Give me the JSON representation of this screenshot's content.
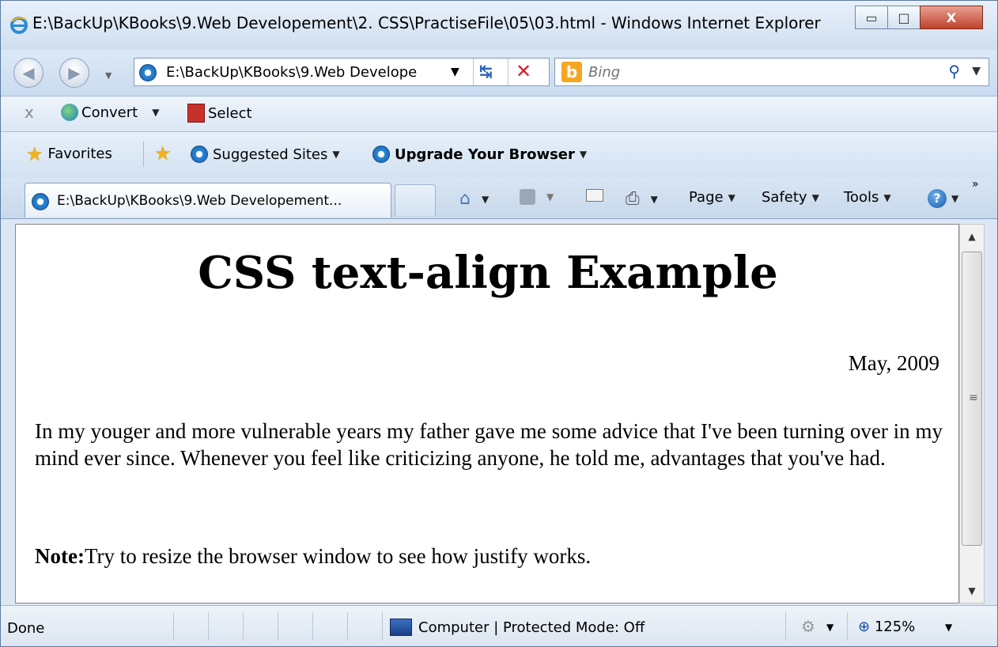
{
  "window": {
    "title": "E:\\BackUp\\KBooks\\9.Web Developement\\2. CSS\\PractiseFile\\05\\03.html - Windows Internet Explorer",
    "minimize_glyph": "▭",
    "maximize_glyph": "□",
    "close_glyph": "X"
  },
  "nav": {
    "back_glyph": "◀",
    "forward_glyph": "▶",
    "address": "E:\\BackUp\\KBooks\\9.Web Develope",
    "refresh_glyph": "↹",
    "stop_glyph": "✕"
  },
  "search": {
    "placeholder": "Bing",
    "logo_letter": "b"
  },
  "convert_toolbar": {
    "close_glyph": "x",
    "convert_label": "Convert",
    "select_label": "Select"
  },
  "favorites_bar": {
    "favorites_label": "Favorites",
    "suggested_sites_label": "Suggested Sites",
    "upgrade_label": "Upgrade Your Browser"
  },
  "tabs": [
    {
      "label": "E:\\BackUp\\KBooks\\9.Web Developement..."
    }
  ],
  "command_bar": {
    "page_label": "Page",
    "safety_label": "Safety",
    "tools_label": "Tools",
    "help_glyph": "?",
    "more_glyph": "»"
  },
  "page": {
    "heading": "CSS text-align Example",
    "date": "May, 2009",
    "paragraph": "In my youger and more vulnerable years my father gave me some advice that I've been turning over in my mind ever since. Whenever you feel like criticizing anyone, he told me, advantages that you've had.",
    "note_label": "Note:",
    "note_text": "Try to resize the browser window to see how justify works."
  },
  "status_bar": {
    "status": "Done",
    "zone": "Computer | Protected Mode: Off",
    "zoom": "125%"
  },
  "colors": {
    "chrome_bg": "#dce7f3",
    "close_button": "#c0432b",
    "bing_orange": "#f5a623"
  }
}
